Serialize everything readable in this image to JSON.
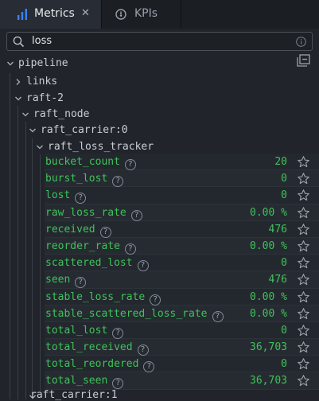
{
  "tabs": [
    {
      "label": "Metrics",
      "icon": "bar-chart-icon",
      "active": true,
      "close": "✕"
    },
    {
      "label": "KPIs",
      "icon": "gauge-icon",
      "active": false
    }
  ],
  "search": {
    "value": "loss"
  },
  "tree": {
    "root": "pipeline",
    "links": "links",
    "raft2": "raft-2",
    "raft_node": "raft_node",
    "raft_carrier0": "raft_carrier:0",
    "tracker": "raft_loss_tracker",
    "raft_carrier1": "raft_carrier:1"
  },
  "metrics": [
    {
      "name": "bucket_count",
      "value": "20"
    },
    {
      "name": "burst_lost",
      "value": "0"
    },
    {
      "name": "lost",
      "value": "0"
    },
    {
      "name": "raw_loss_rate",
      "value": "0.00 %"
    },
    {
      "name": "received",
      "value": "476"
    },
    {
      "name": "reorder_rate",
      "value": "0.00 %"
    },
    {
      "name": "scattered_lost",
      "value": "0"
    },
    {
      "name": "seen",
      "value": "476"
    },
    {
      "name": "stable_loss_rate",
      "value": "0.00 %"
    },
    {
      "name": "stable_scattered_loss_rate",
      "value": "0.00 %"
    },
    {
      "name": "total_lost",
      "value": "0"
    },
    {
      "name": "total_received",
      "value": "36,703"
    },
    {
      "name": "total_reordered",
      "value": "0"
    },
    {
      "name": "total_seen",
      "value": "36,703"
    }
  ],
  "colors": {
    "metric": "#3fc25a",
    "accent": "#3b82f6"
  }
}
